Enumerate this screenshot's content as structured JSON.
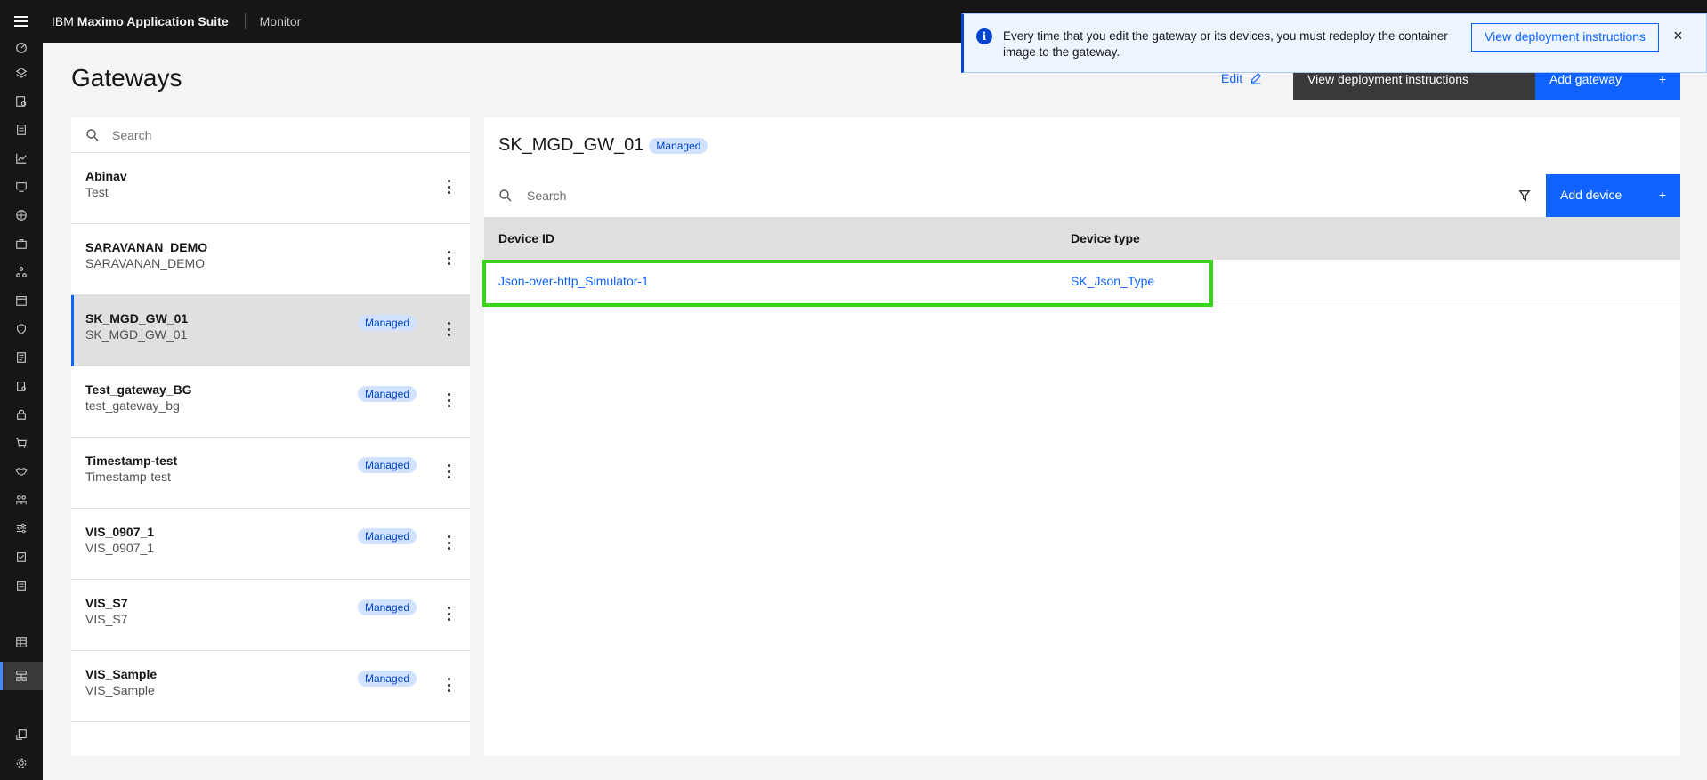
{
  "header": {
    "brand_prefix": "IBM",
    "brand_name": "Maximo Application Suite",
    "app_name": "Monitor"
  },
  "page": {
    "title": "Gateways",
    "edit_label": "Edit",
    "view_instructions_label": "View deployment instructions",
    "add_gateway_label": "Add gateway",
    "add_icon": "+"
  },
  "notification": {
    "message": "Every time that you edit the gateway or its devices, you must redeploy the container image to the gateway.",
    "action_label": "View deployment instructions",
    "close_glyph": "×",
    "info_glyph": "i"
  },
  "gateway_list": {
    "search_placeholder": "Search",
    "items": [
      {
        "name": "Abinav",
        "sub": "Test",
        "tag": ""
      },
      {
        "name": "SARAVANAN_DEMO",
        "sub": "SARAVANAN_DEMO",
        "tag": ""
      },
      {
        "name": "SK_MGD_GW_01",
        "sub": "SK_MGD_GW_01",
        "tag": "Managed"
      },
      {
        "name": "Test_gateway_BG",
        "sub": "test_gateway_bg",
        "tag": "Managed"
      },
      {
        "name": "Timestamp-test",
        "sub": "Timestamp-test",
        "tag": "Managed"
      },
      {
        "name": "VIS_0907_1",
        "sub": "VIS_0907_1",
        "tag": "Managed"
      },
      {
        "name": "VIS_S7",
        "sub": "VIS_S7",
        "tag": "Managed"
      },
      {
        "name": "VIS_Sample",
        "sub": "VIS_Sample",
        "tag": "Managed"
      }
    ]
  },
  "detail": {
    "title": "SK_MGD_GW_01",
    "tag": "Managed",
    "search_placeholder": "Search",
    "add_device_label": "Add device",
    "add_icon": "+",
    "columns": [
      "Device ID",
      "Device type"
    ],
    "rows": [
      {
        "device_id": "Json-over-http_Simulator-1",
        "device_type": "SK_Json_Type"
      }
    ]
  },
  "colors": {
    "accent": "#0f62fe",
    "highlight": "#38d41b",
    "tag_bg": "#d0e2ff"
  }
}
